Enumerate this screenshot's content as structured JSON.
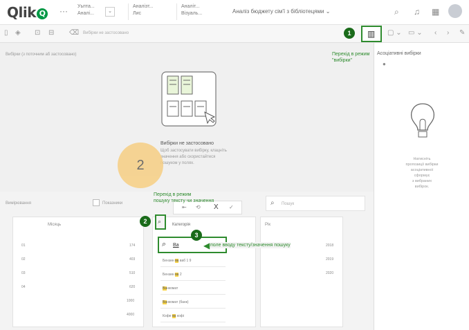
{
  "header": {
    "logo_text": "Qlik",
    "logo_mark": "Q",
    "more_icon": "···",
    "dropdowns": [
      {
        "line1": "Уьпта...",
        "line2": "Аналі..."
      },
      {
        "line1": "Аналізт...",
        "line2": "Лис"
      },
      {
        "line1": "Аналіт...",
        "line2": "Візуаль..."
      }
    ],
    "app_title": "Аналіз бюджету сім'ї з бібліотецями",
    "app_title_caret": "⌄"
  },
  "toolbar2": {
    "hint": "Вибірки не застосовано"
  },
  "selections": {
    "label": "Вибірки (з поточним аб застосовано)",
    "empty_title": "Вибірки не застосовано",
    "empty_text_1": "Щоб застосувати вибірку, клацніть",
    "empty_text_2": "значення або скористайтеся",
    "empty_text_3": "пошуком у полях."
  },
  "annotations": {
    "badge1": "1",
    "badge2": "2",
    "badge3": "3",
    "big_number": "2",
    "note1_line1": "Перехід в режим",
    "note1_line2": "\"вибірки\"",
    "note2_line1": "Перехід в режим",
    "note2_line2": "пошуку тексту чи значення",
    "note3": "поле вводу тексту/значення пошуку"
  },
  "right_panel": {
    "title": "Асоціативні вибірки",
    "info_line1": "Натисніть",
    "info_line2": "пропозиції вибірки",
    "info_line3": "асоціативної",
    "info_line4": "сформує",
    "info_line5": "з вибраних",
    "info_line6": "вибірок.",
    "info_line7": "",
    "info_line8": ""
  },
  "lower": {
    "label": "Вимірювання",
    "checkbox_label": "Показники",
    "search_placeholder": "Пошук",
    "col1_header": "Місяць",
    "col2_header": "Категорія",
    "col3_header": "Рік",
    "col1_values": [
      "01",
      "02",
      "03",
      "04"
    ],
    "col1_nums": [
      "174",
      "403",
      "510",
      "620",
      "1000",
      "4000"
    ],
    "col3_values": [
      "2018",
      "2019",
      "2020"
    ],
    "search_field_text": "Ва",
    "list_items": [
      {
        "before": "Бензин ",
        "hl": "ва",
        "after": " ваб 1 9"
      },
      {
        "before": "Бензин ",
        "hl": "ва",
        "after": " 2"
      },
      {
        "before": "",
        "hl": "Ва",
        "after": "нкомат"
      },
      {
        "before": "",
        "hl": "Ва",
        "after": "нкомат (банк)"
      },
      {
        "before": "Кофе ",
        "hl": "ва",
        "after": " кофі"
      }
    ],
    "popup_icons": [
      "⇤",
      "⟲",
      "X",
      "✓"
    ]
  },
  "colors": {
    "accent_green": "#009845",
    "annotation_green": "#2e8b2e",
    "highlight": "#f8d449",
    "orange_circle": "#f7cf83"
  }
}
